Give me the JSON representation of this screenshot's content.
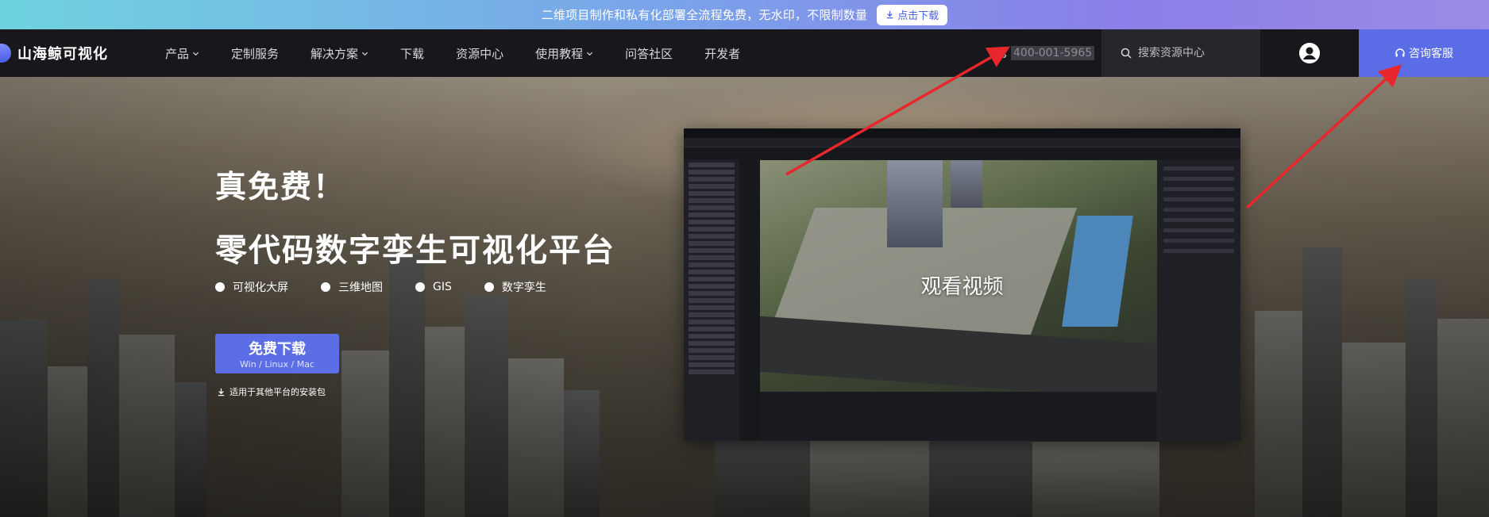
{
  "promo": {
    "text": "二维项目制作和私有化部署全流程免费，无水印，不限制数量",
    "button_label": "点击下载"
  },
  "nav": {
    "logo_text": "山海鲸可视化",
    "items": [
      {
        "label": "产品",
        "dropdown": true
      },
      {
        "label": "定制服务",
        "dropdown": false
      },
      {
        "label": "解决方案",
        "dropdown": true
      },
      {
        "label": "下载",
        "dropdown": false
      },
      {
        "label": "资源中心",
        "dropdown": false
      },
      {
        "label": "使用教程",
        "dropdown": true
      },
      {
        "label": "问答社区",
        "dropdown": false
      },
      {
        "label": "开发者",
        "dropdown": false
      }
    ],
    "phone": "400-001-5965",
    "search_placeholder": "搜索资源中心",
    "consult_label": "咨询客服"
  },
  "hero": {
    "title": "真免费！",
    "subtitle": "零代码数字孪生可视化平台",
    "tags": [
      "可视化大屏",
      "三维地图",
      "GIS",
      "数字孪生"
    ],
    "cta_main": "免费下载",
    "cta_sub": "Win / Linux / Mac",
    "other_platforms": "适用于其他平台的安装包",
    "video_label": "观看视频"
  },
  "colors": {
    "accent": "#5a6de6",
    "nav_bg": "#18181c",
    "annotation_arrow": "#e8262b"
  }
}
